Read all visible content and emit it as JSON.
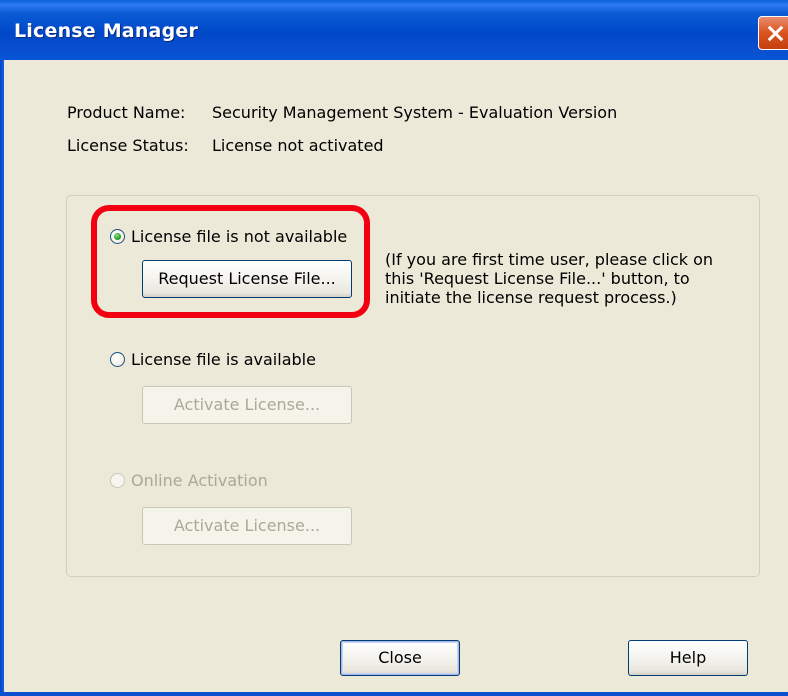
{
  "window": {
    "title": "License Manager"
  },
  "info": {
    "product_name_label": "Product Name:",
    "product_name_value": "Security Management System - Evaluation Version",
    "license_status_label": "License Status:",
    "license_status_value": "License not activated"
  },
  "options": {
    "not_available": {
      "label": "License file is not available",
      "selected": true,
      "button_label": "Request License File...",
      "help_text": "(If you are first time user, please click on this 'Request License File...' button, to initiate the license request process.)"
    },
    "available": {
      "label": "License file is available",
      "selected": false,
      "button_label": "Activate License..."
    },
    "online": {
      "label": "Online Activation",
      "selected": false,
      "enabled": false,
      "button_label": "Activate License..."
    }
  },
  "footer": {
    "close_label": "Close",
    "help_label": "Help"
  },
  "colors": {
    "titlebar": "#0048c8",
    "highlight": "#f20012",
    "window_bg": "#ece9d8"
  },
  "icons": {
    "close": "close-x-icon"
  }
}
